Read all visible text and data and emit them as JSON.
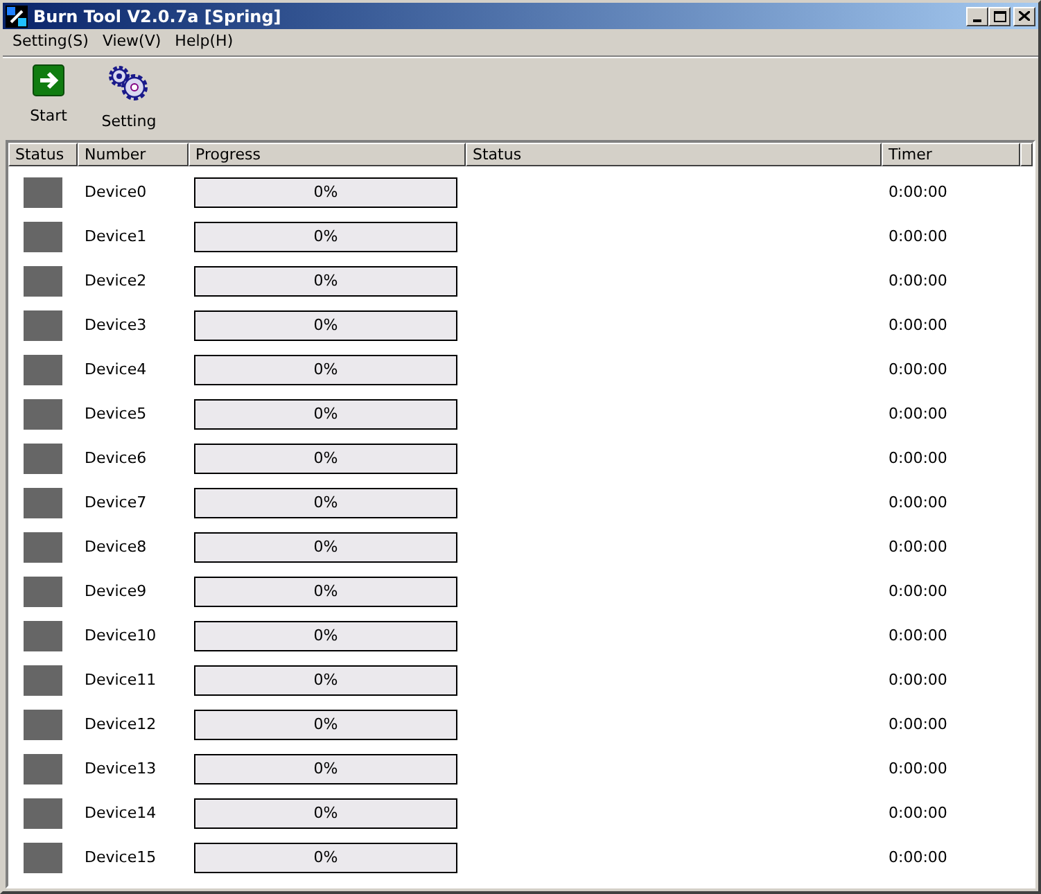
{
  "window": {
    "title": "Burn Tool V2.0.7a [Spring]"
  },
  "menu": [
    "Setting(S)",
    "View(V)",
    "Help(H)"
  ],
  "toolbar": [
    {
      "kind": "start",
      "label": "Start"
    },
    {
      "kind": "setting",
      "label": "Setting"
    }
  ],
  "table": {
    "columns": [
      "Status",
      "Number",
      "Progress",
      "Status",
      "Timer"
    ],
    "rows": [
      {
        "color": "#666666",
        "number": "Device0",
        "level": 0,
        "progress": "0%",
        "timer": "0:00:00"
      },
      {
        "color": "#666666",
        "number": "Device1",
        "level": 0,
        "progress": "0%",
        "timer": "0:00:00"
      },
      {
        "color": "#666666",
        "number": "Device2",
        "level": 0,
        "progress": "0%",
        "timer": "0:00:00"
      },
      {
        "color": "#666666",
        "number": "Device3",
        "level": 0,
        "progress": "0%",
        "timer": "0:00:00"
      },
      {
        "color": "#666666",
        "number": "Device4",
        "level": 0,
        "progress": "0%",
        "timer": "0:00:00"
      },
      {
        "color": "#666666",
        "number": "Device5",
        "level": 0,
        "progress": "0%",
        "timer": "0:00:00"
      },
      {
        "color": "#666666",
        "number": "Device6",
        "level": 0,
        "progress": "0%",
        "timer": "0:00:00"
      },
      {
        "color": "#666666",
        "number": "Device7",
        "level": 0,
        "progress": "0%",
        "timer": "0:00:00"
      },
      {
        "color": "#666666",
        "number": "Device8",
        "level": 0,
        "progress": "0%",
        "timer": "0:00:00"
      },
      {
        "color": "#666666",
        "number": "Device9",
        "level": 0,
        "progress": "0%",
        "timer": "0:00:00"
      },
      {
        "color": "#666666",
        "number": "Device10",
        "level": 0,
        "progress": "0%",
        "timer": "0:00:00"
      },
      {
        "color": "#666666",
        "number": "Device11",
        "level": 0,
        "progress": "0%",
        "timer": "0:00:00"
      },
      {
        "color": "#666666",
        "number": "Device12",
        "level": 0,
        "progress": "0%",
        "timer": "0:00:00"
      },
      {
        "color": "#666666",
        "number": "Device13",
        "level": 0,
        "progress": "0%",
        "timer": "0:00:00"
      },
      {
        "color": "#666666",
        "number": "Device14",
        "level": 0,
        "progress": "0%",
        "timer": "0:00:00"
      },
      {
        "color": "#666666",
        "number": "Device15",
        "level": 0,
        "progress": "0%",
        "timer": "0:00:00"
      }
    ]
  }
}
